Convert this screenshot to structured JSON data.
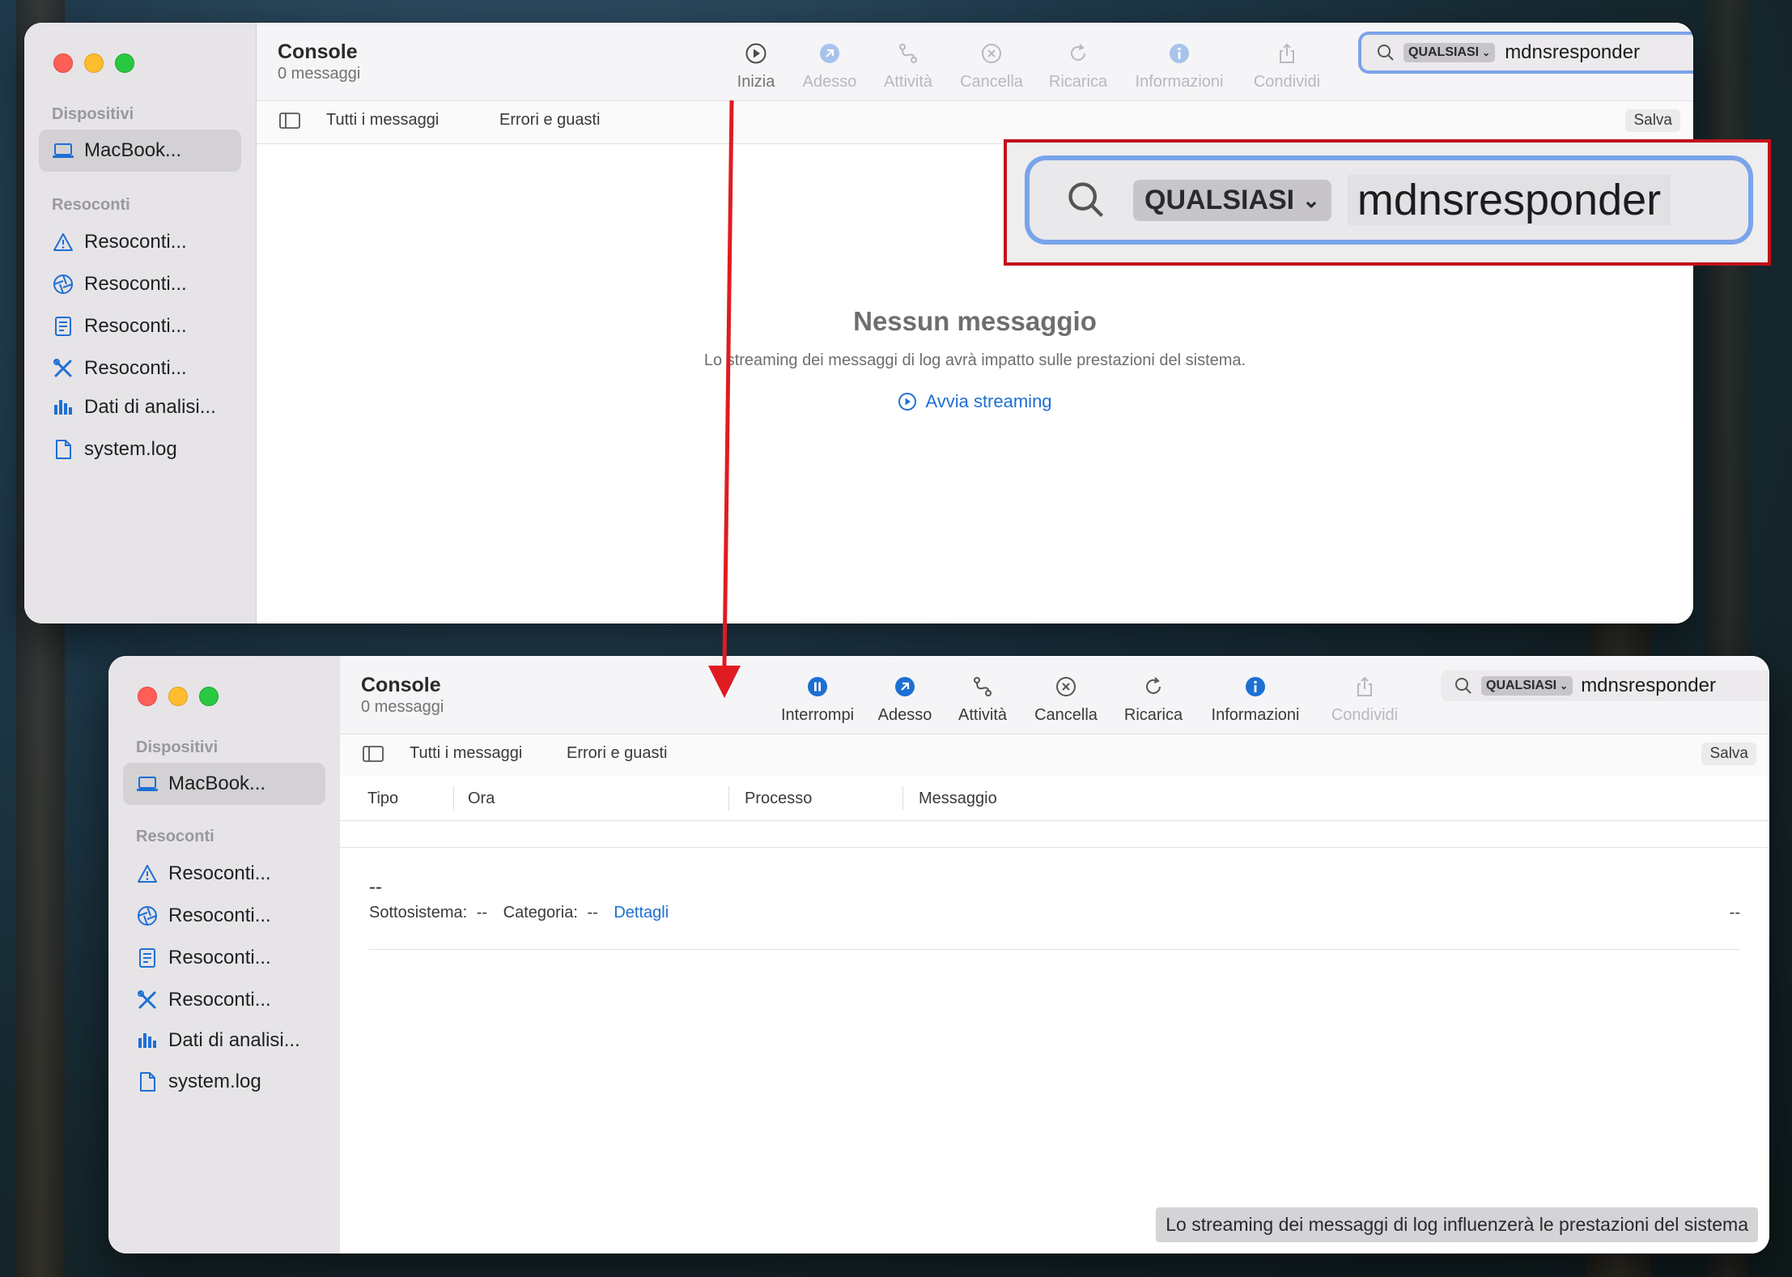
{
  "colors": {
    "accent": "#1e6fd4",
    "highlight": "#c2101a",
    "arrow": "#e01b22"
  },
  "window_top": {
    "app_title": "Console",
    "message_count": "0 messaggi",
    "toolbar": [
      {
        "label": "Inizia",
        "icon": "play-circle-icon"
      },
      {
        "label": "Adesso",
        "icon": "arrow-now-icon"
      },
      {
        "label": "Attività",
        "icon": "activity-icon"
      },
      {
        "label": "Cancella",
        "icon": "clear-icon"
      },
      {
        "label": "Ricarica",
        "icon": "reload-icon"
      },
      {
        "label": "Informazioni",
        "icon": "info-icon"
      },
      {
        "label": "Condividi",
        "icon": "share-icon"
      }
    ],
    "search": {
      "scope": "QUALSIASI",
      "query": "mdnsresponder"
    },
    "filters": {
      "all": "Tutti i messaggi",
      "errors": "Errori e guasti",
      "save": "Salva"
    },
    "empty": {
      "title": "Nessun messaggio",
      "description": "Lo streaming dei messaggi di log avrà impatto sulle prestazioni del sistema.",
      "action": "Avvia streaming"
    }
  },
  "zoom_callout": {
    "scope": "QUALSIASI",
    "query": "mdnsresponder"
  },
  "sidebar": {
    "devices_header": "Dispositivi",
    "device": "MacBook...",
    "reports_header": "Resoconti",
    "items": [
      {
        "label": "Resoconti...",
        "icon": "warning-icon"
      },
      {
        "label": "Resoconti...",
        "icon": "aperture-icon"
      },
      {
        "label": "Resoconti...",
        "icon": "document-icon"
      },
      {
        "label": "Resoconti...",
        "icon": "tools-icon"
      },
      {
        "label": "Dati di analisi...",
        "icon": "bar-chart-icon"
      },
      {
        "label": "system.log",
        "icon": "file-icon"
      }
    ]
  },
  "window_bottom": {
    "app_title": "Console",
    "message_count": "0 messaggi",
    "toolbar": [
      {
        "label": "Interrompi",
        "icon": "pause-circle-icon"
      },
      {
        "label": "Adesso",
        "icon": "arrow-now-icon"
      },
      {
        "label": "Attività",
        "icon": "activity-icon"
      },
      {
        "label": "Cancella",
        "icon": "clear-icon"
      },
      {
        "label": "Ricarica",
        "icon": "reload-icon"
      },
      {
        "label": "Informazioni",
        "icon": "info-icon"
      },
      {
        "label": "Condividi",
        "icon": "share-icon"
      }
    ],
    "search": {
      "scope": "QUALSIASI",
      "query": "mdnsresponder"
    },
    "filters": {
      "all": "Tutti i messaggi",
      "errors": "Errori e guasti",
      "save": "Salva"
    },
    "columns": [
      "Tipo",
      "Ora",
      "Processo",
      "Messaggio"
    ],
    "detail": {
      "dash": "--",
      "subsystem_label": "Sottosistema:",
      "subsystem_value": "--",
      "category_label": "Categoria:",
      "category_value": "--",
      "details_link": "Dettagli",
      "right_value": "--"
    },
    "status_banner": "Lo streaming dei messaggi di log influenzerà le prestazioni del sistema"
  }
}
